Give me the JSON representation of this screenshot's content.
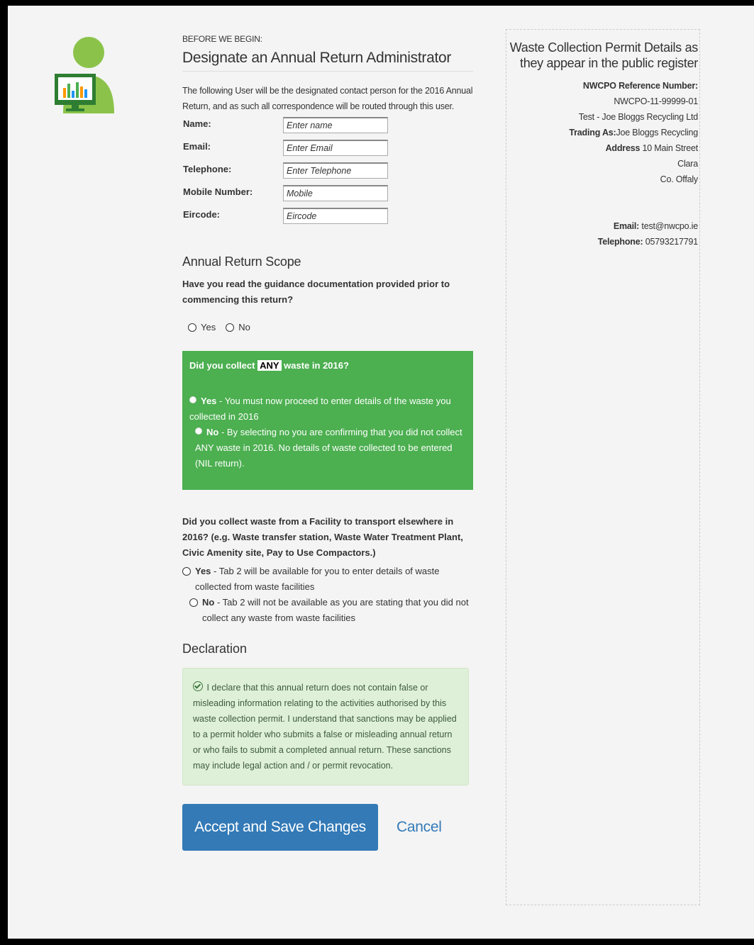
{
  "header": {
    "kicker": "BEFORE WE BEGIN:",
    "title": "Designate an Annual Return Administrator",
    "intro": "The following User will be the designated contact person for the 2016 Annual Return, and as such all correspondence will be routed through this user."
  },
  "form": {
    "fields": [
      {
        "label": "Name:",
        "placeholder": "Enter name"
      },
      {
        "label": "Email:",
        "placeholder": "Enter Email"
      },
      {
        "label": "Telephone:",
        "placeholder": "Enter Telephone"
      },
      {
        "label": "Mobile Number:",
        "placeholder": "Mobile"
      },
      {
        "label": "Eircode:",
        "placeholder": "Eircode"
      }
    ]
  },
  "scope": {
    "heading": "Annual Return Scope",
    "question": "Have you read the guidance documentation provided prior to commencing this return?",
    "yes": "Yes",
    "no": "No"
  },
  "collect": {
    "q_prefix": "Did you collect",
    "q_highlight": "ANY",
    "q_suffix": "waste in 2016?",
    "yes_bold": "Yes",
    "yes_text": "- You must now proceed to enter details of the waste you collected in 2016",
    "no_bold": "No",
    "no_text": "- By selecting no you are confirming that you did not collect ANY waste in 2016. No details of waste collected to be entered (NIL return)."
  },
  "facility": {
    "question": "Did you collect waste from a Facility to transport elsewhere in 2016? (e.g. Waste transfer station, Waste Water Treatment Plant, Civic Amenity site, Pay to Use Compactors.)",
    "yes_bold": "Yes",
    "yes_text": "- Tab 2 will be available for you to enter details of waste collected from waste facilities",
    "no_bold": "No",
    "no_text": "- Tab 2 will not be available as you are stating that you did not collect any waste from waste facilities"
  },
  "declaration": {
    "heading": "Declaration",
    "text": "I declare that this annual return does not contain false or misleading information relating to the activities authorised by this waste collection permit. I understand that sanctions may be applied to a permit holder who submits a false or misleading annual return or who fails to submit a completed annual return. These sanctions may include legal action and / or permit revocation."
  },
  "actions": {
    "accept_label": "Accept and Save Changes",
    "cancel_label": "Cancel"
  },
  "permit": {
    "title": "Waste Collection Permit Details as they appear in the public register",
    "ref_label": "NWCPO Reference Number:",
    "ref_value": "NWCPO-11-99999-01",
    "holder": "Test - Joe Bloggs Recycling Ltd",
    "trading_label": "Trading As:",
    "trading_value": "Joe Bloggs Recycling",
    "address_label": "Address",
    "address_line1": "10 Main Street",
    "address_line2": "Clara",
    "address_line3": "Co. Offaly",
    "email_label": "Email:",
    "email_value": "test@nwcpo.ie",
    "phone_label": "Telephone:",
    "phone_value": "05793217791"
  },
  "colors": {
    "green_panel": "#4caf50",
    "primary_button": "#337ab7",
    "declaration_bg": "#dff0d8"
  },
  "icons": [
    "user-chart-icon",
    "check-circle-icon"
  ]
}
